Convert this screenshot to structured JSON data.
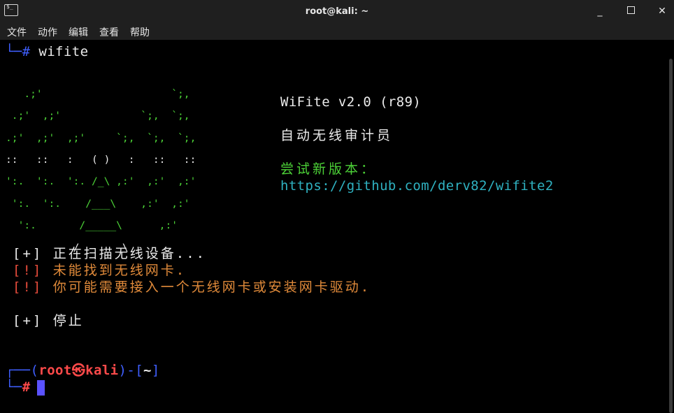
{
  "window": {
    "title": "root@kali: ~",
    "minimize_symbol": "_",
    "close_symbol": "✕"
  },
  "menu": {
    "items": [
      "文件",
      "动作",
      "编辑",
      "查看",
      "帮助"
    ]
  },
  "terminal": {
    "first_prompt_symbol": "└─#",
    "first_command": "wifite",
    "ascii_art": [
      "   .;'                     `;,    ",
      " .;'  ,;'             `;,  `;,   ",
      ".;'  ,;'  ,;'     `;,  `;,  `;,  ",
      "::   ::   :   ( )   :   ::   ::  ",
      "':.  ':.  ':. /_\\ ,:'  ,:'  ,:'  ",
      " ':.  ':.    /___\\    ,:'  ,:'   ",
      "  ':.       /_____\\      ,:'     ",
      "           /       \\             "
    ],
    "banner": {
      "name": "WiFite v2.0 (r89)",
      "subtitle": "自动无线审计员",
      "try_label": "尝试新版本：",
      "url": "https://github.com/derv82/wifite2"
    },
    "messages": [
      {
        "tag": "[+]",
        "text": "正在扫描无线设备...",
        "level": "info"
      },
      {
        "tag": "[!]",
        "text": "未能找到无线网卡.",
        "level": "error"
      },
      {
        "tag": "[!]",
        "text": "你可能需要接入一个无线网卡或安装网卡驱动.",
        "level": "error"
      },
      {
        "tag": "[+]",
        "text": "停止",
        "level": "info"
      }
    ],
    "prompt": {
      "corner_top": "┌──",
      "open_paren": "(",
      "user": "root",
      "at_symbol": "㉿",
      "host": "kali",
      "close_paren": ")",
      "separator": "-",
      "dir_open": "[",
      "dir": "~",
      "dir_close": "]",
      "corner_bottom": "└─",
      "hash": "#"
    }
  },
  "colors": {
    "titlebar_bg": "#1f1f1f",
    "terminal_bg": "#000000",
    "art_green": "#4cd137",
    "error_red": "#e74c3c",
    "error_text_orange": "#e08a3a",
    "url_cyan": "#2fb1c0",
    "prompt_blue": "#3f5fff",
    "prompt_red": "#ff4a4a",
    "cursor": "#5a52ff"
  }
}
